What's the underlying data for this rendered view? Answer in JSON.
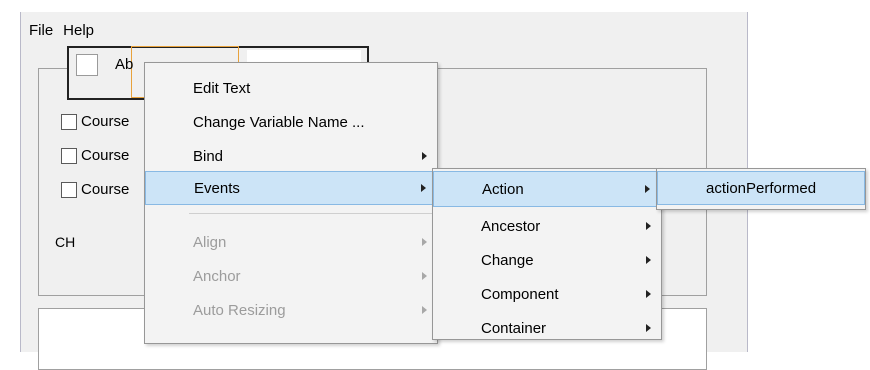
{
  "menubar": {
    "file": "File",
    "help": "Help"
  },
  "form": {
    "top_checkbox_label": "Ab",
    "checkboxes": [
      "Course",
      "Course",
      "Course"
    ],
    "ch_label": "CH"
  },
  "context_menu": {
    "items": [
      {
        "label": "Edit Text"
      },
      {
        "label": "Change Variable Name ..."
      },
      {
        "label": "Bind"
      },
      {
        "label": "Events"
      },
      {
        "label": "Align"
      },
      {
        "label": "Anchor"
      },
      {
        "label": "Auto Resizing"
      }
    ]
  },
  "events_submenu": {
    "items": [
      {
        "label": "Action"
      },
      {
        "label": "Ancestor"
      },
      {
        "label": "Change"
      },
      {
        "label": "Component"
      },
      {
        "label": "Container"
      }
    ]
  },
  "action_submenu": {
    "items": [
      {
        "label": "actionPerformed"
      }
    ]
  },
  "colors": {
    "highlight": "#cce4f7",
    "highlight_border": "#88b9e4",
    "selection_orange": "#e8a23c"
  }
}
